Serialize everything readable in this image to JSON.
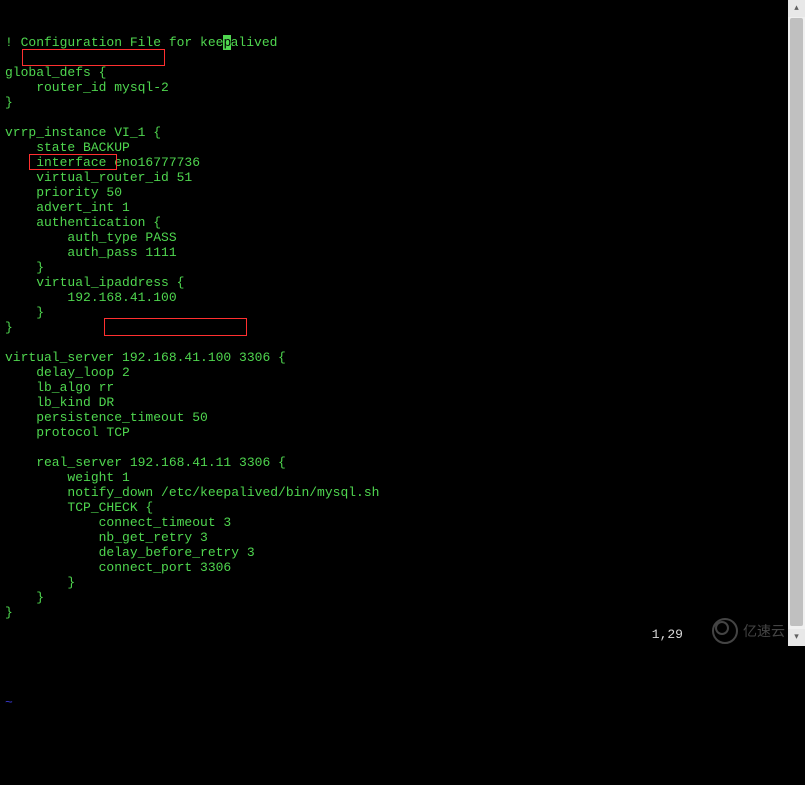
{
  "lines": [
    {
      "indent": 0,
      "pre": "! Configuration File for kee",
      "cursor": "p",
      "post": "alived"
    },
    {
      "indent": 0,
      "text": ""
    },
    {
      "indent": 0,
      "text": "global_defs {"
    },
    {
      "indent": 1,
      "text": "router_id mysql-2"
    },
    {
      "indent": 0,
      "text": "}"
    },
    {
      "indent": 0,
      "text": ""
    },
    {
      "indent": 0,
      "text": "vrrp_instance VI_1 {"
    },
    {
      "indent": 1,
      "text": "state BACKUP"
    },
    {
      "indent": 1,
      "text": "interface eno16777736"
    },
    {
      "indent": 1,
      "text": "virtual_router_id 51"
    },
    {
      "indent": 1,
      "text": "priority 50"
    },
    {
      "indent": 1,
      "text": "advert_int 1"
    },
    {
      "indent": 1,
      "text": "authentication {"
    },
    {
      "indent": 2,
      "text": "auth_type PASS"
    },
    {
      "indent": 2,
      "text": "auth_pass 1111"
    },
    {
      "indent": 1,
      "text": "}"
    },
    {
      "indent": 1,
      "text": "virtual_ipaddress {"
    },
    {
      "indent": 2,
      "text": "192.168.41.100"
    },
    {
      "indent": 1,
      "text": "}"
    },
    {
      "indent": 0,
      "text": "}"
    },
    {
      "indent": 0,
      "text": ""
    },
    {
      "indent": 0,
      "text": "virtual_server 192.168.41.100 3306 {"
    },
    {
      "indent": 1,
      "text": "delay_loop 2"
    },
    {
      "indent": 1,
      "text": "lb_algo rr"
    },
    {
      "indent": 1,
      "text": "lb_kind DR"
    },
    {
      "indent": 1,
      "text": "persistence_timeout 50"
    },
    {
      "indent": 1,
      "text": "protocol TCP"
    },
    {
      "indent": 0,
      "text": ""
    },
    {
      "indent": 1,
      "text": "real_server 192.168.41.11 3306 {"
    },
    {
      "indent": 2,
      "text": "weight 1"
    },
    {
      "indent": 2,
      "text": "notify_down /etc/keepalived/bin/mysql.sh"
    },
    {
      "indent": 2,
      "text": "TCP_CHECK {"
    },
    {
      "indent": 3,
      "text": "connect_timeout 3"
    },
    {
      "indent": 3,
      "text": "nb_get_retry 3"
    },
    {
      "indent": 3,
      "text": "delay_before_retry 3"
    },
    {
      "indent": 3,
      "text": "connect_port 3306"
    },
    {
      "indent": 2,
      "text": "}"
    },
    {
      "indent": 1,
      "text": "}"
    },
    {
      "indent": 0,
      "text": "}"
    }
  ],
  "tilde": "~",
  "status": {
    "position": "1,29"
  },
  "watermark_text": "亿速云"
}
